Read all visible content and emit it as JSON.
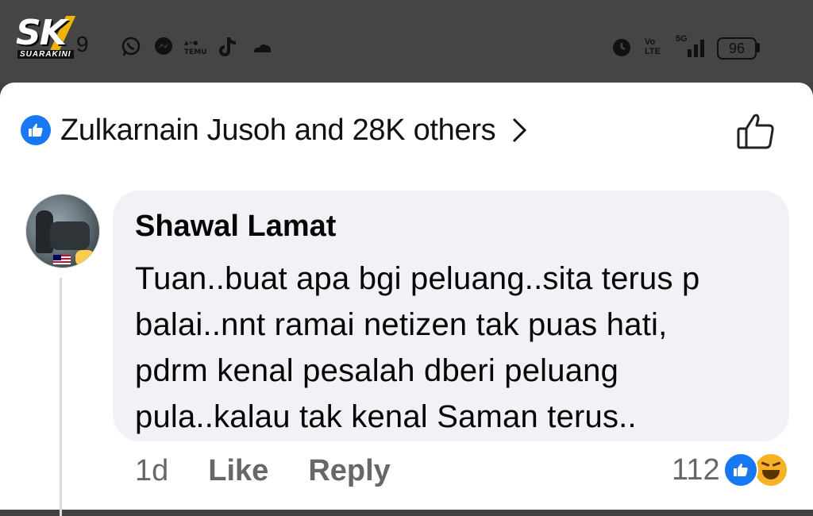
{
  "status_bar": {
    "logo_text": "SK",
    "logo_subtext": "SUARAKINI",
    "time_fragment": "9",
    "temu_label": "TEMU",
    "volte_label": "Vo\nLTE",
    "network": "5G",
    "battery": "96",
    "icons": [
      "whatsapp-icon",
      "messenger-icon",
      "temu-icon",
      "tiktok-icon",
      "cloud-icon",
      "alarm-icon",
      "signal-icon"
    ]
  },
  "reactions_header": {
    "text": "Zulkarnain Jusoh and 28K others",
    "icon": "like-reaction-icon",
    "chevron": "chevron-right-icon",
    "like_button_icon": "thumbs-up-outline-icon"
  },
  "comment": {
    "author": "Shawal Lamat",
    "text": "Tuan..buat apa bgi peluang..sita terus p\nbalai..nnt ramai netizen tak puas hati,\npdrm kenal pesalah dberi peluang\npula..kalau tak kenal Saman terus..",
    "time": "1d",
    "like_label": "Like",
    "reply_label": "Reply",
    "reaction_count": "112",
    "reaction_icons": [
      "like-reaction-icon",
      "haha-reaction-icon"
    ]
  },
  "colors": {
    "accent": "#1877f2",
    "bubble": "#f0f2f5",
    "status_bar": "#454545",
    "muted_text": "#65676b",
    "haha": "#f7b125"
  }
}
